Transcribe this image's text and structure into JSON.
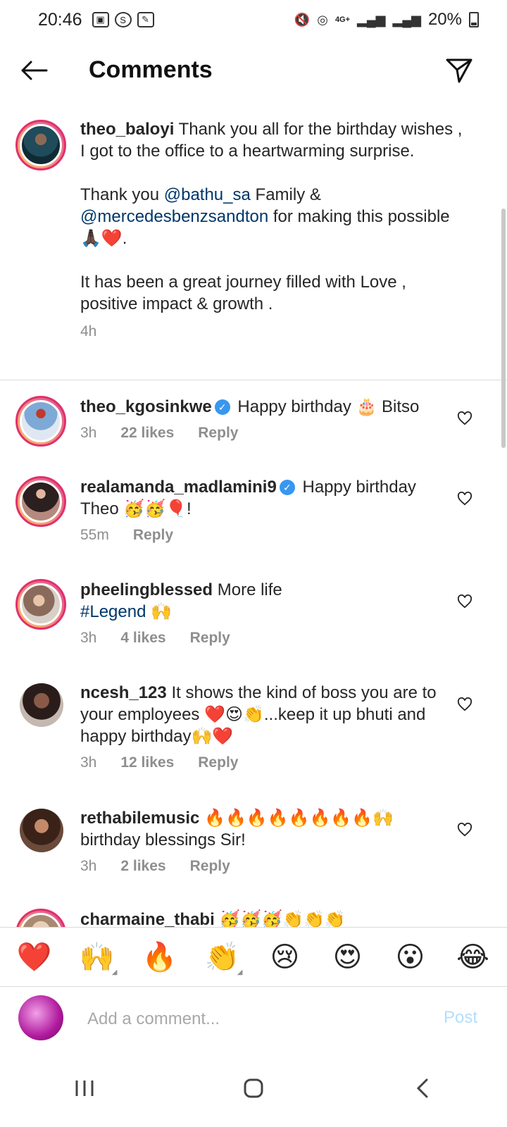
{
  "status_bar": {
    "time": "20:46",
    "battery": "20%",
    "network": "4G+"
  },
  "header": {
    "title": "Comments"
  },
  "caption": {
    "username": "theo_baloyi",
    "line1": "Thank you all for the birthday wishes , I got to the office to a heartwarming surprise.",
    "line2_prefix": "Thank you ",
    "mention1": "@bathu_sa",
    "line2_mid": " Family & ",
    "mention2": "@mercedesbenzsandton",
    "line2_suffix": " for making this possible 🙏🏿❤️.",
    "line3": "It has been a great journey filled with Love , positive impact & growth .",
    "time": "4h"
  },
  "comments": [
    {
      "username": "theo_kgosinkwe",
      "text": "Happy birthday 🎂 Bitso",
      "time": "3h",
      "likes": "22 likes",
      "reply": "Reply"
    },
    {
      "username": "realamanda_madlamini9",
      "text": "Happy birthday Theo 🥳🥳🎈!",
      "time": "55m",
      "reply": "Reply"
    },
    {
      "username": "pheelingblessed",
      "text": "More life",
      "hashtag": "#Legend",
      "text2": " 🙌",
      "time": "3h",
      "likes": "4 likes",
      "reply": "Reply"
    },
    {
      "username": "ncesh_123",
      "text": "It shows the kind of boss you are to your employees ❤️😍👏...keep it up bhuti and happy birthday🙌❤️",
      "time": "3h",
      "likes": "12 likes",
      "reply": "Reply"
    },
    {
      "username": "rethabilemusic",
      "text": "🔥🔥🔥🔥🔥🔥🔥🔥🙌 birthday blessings Sir!",
      "time": "3h",
      "likes": "2 likes",
      "reply": "Reply"
    },
    {
      "username": "charmaine_thabi",
      "text": "🥳🥳🥳👏👏👏"
    }
  ],
  "emoji_bar": [
    "❤️",
    "🙌",
    "🔥",
    "👏",
    "😢",
    "😍",
    "😮",
    "😂"
  ],
  "input": {
    "placeholder": "Add a comment...",
    "post_label": "Post"
  }
}
